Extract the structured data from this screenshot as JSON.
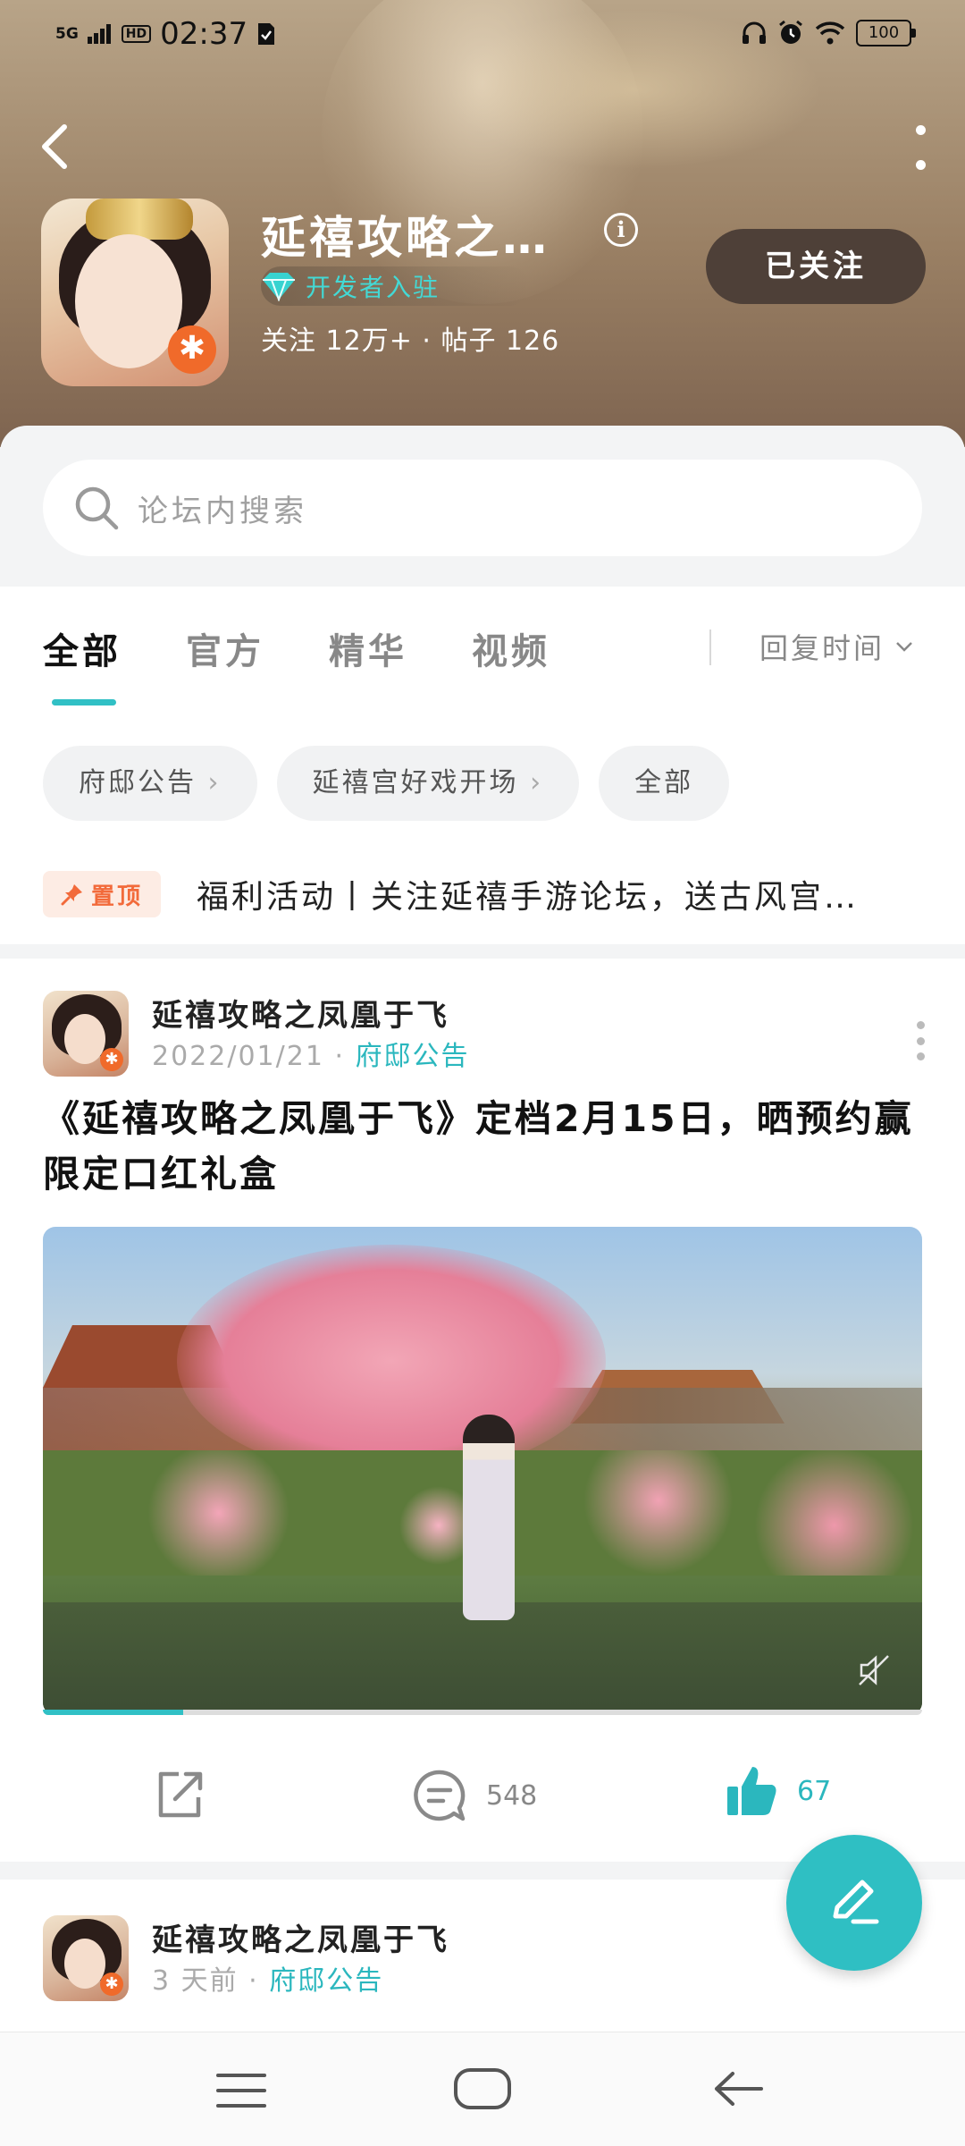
{
  "status_bar": {
    "network": "5G",
    "hd": "HD",
    "time": "02:37",
    "battery": "100"
  },
  "header": {
    "game_title": "延禧攻略之…",
    "developer_badge": "开发者入驻",
    "stats": "关注 12万+ · 帖子 126",
    "follow_button": "已关注"
  },
  "search": {
    "placeholder": "论坛内搜索"
  },
  "tabs": [
    {
      "label": "全部",
      "active": true
    },
    {
      "label": "官方",
      "active": false
    },
    {
      "label": "精华",
      "active": false
    },
    {
      "label": "视频",
      "active": false
    }
  ],
  "sort": {
    "label": "回复时间"
  },
  "chips": [
    {
      "label": "府邸公告",
      "arrow": "›"
    },
    {
      "label": "延禧宫好戏开场",
      "arrow": "›"
    },
    {
      "label": "全部",
      "arrow": ""
    }
  ],
  "pinned": {
    "tag": "置顶",
    "text": "福利活动丨关注延禧手游论坛，送古风宫…"
  },
  "posts": [
    {
      "author": "延禧攻略之凤凰于飞",
      "date": "2022/01/21",
      "separator": "·",
      "category": "府邸公告",
      "title": "《延禧攻略之凤凰于飞》定档2月15日，晒预约赢限定口红礼盒",
      "video_progress": 0.16,
      "comments": "548",
      "likes": "67"
    },
    {
      "author": "延禧攻略之凤凰于飞",
      "date": "3 天前",
      "separator": "·",
      "category": "府邸公告"
    }
  ],
  "colors": {
    "accent": "#31c0c5",
    "pin": "#f26a3a",
    "follow_bg": "#4e4038"
  }
}
